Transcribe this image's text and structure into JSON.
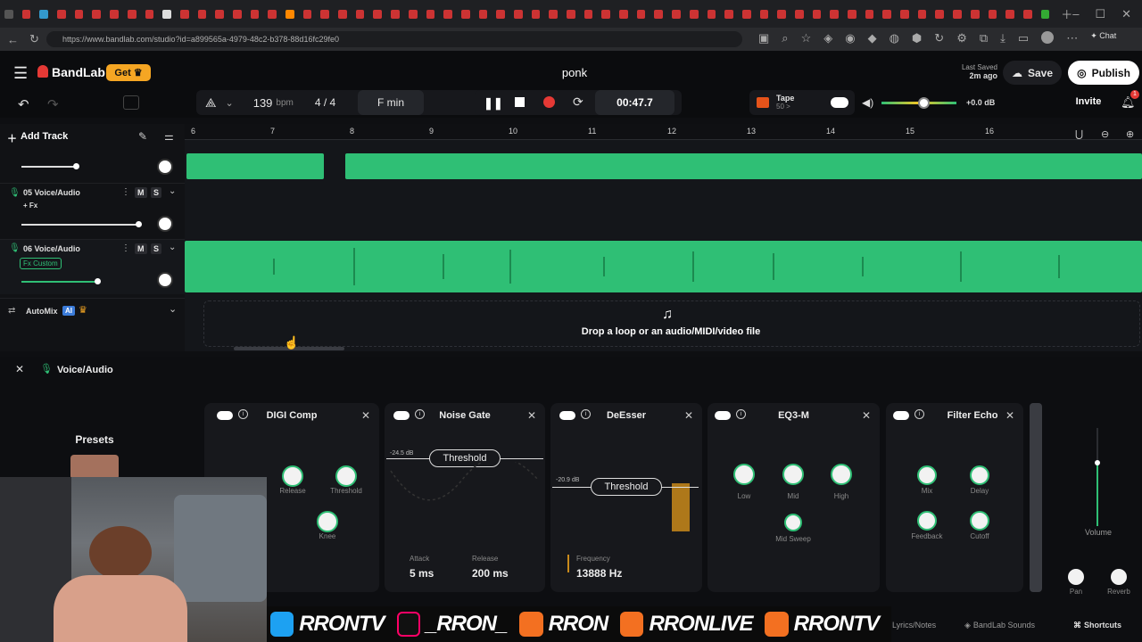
{
  "browser": {
    "url": "https://www.bandlab.com/studio?id=a899565a-4979-48c2-b378-88d16fc29fe0"
  },
  "header": {
    "brand": "BandLab",
    "get_label": "Get",
    "project_title": "ponk",
    "last_saved_label": "Last Saved",
    "last_saved_time": "2m ago",
    "save_label": "Save",
    "publish_label": "Publish"
  },
  "transport": {
    "bpm": "139",
    "bpm_unit": "bpm",
    "time_sig": "4 / 4",
    "key": "F min",
    "time": "00:47.7",
    "tape_label": "Tape",
    "tape_value": "50 >",
    "volume_db": "+0.0 dB",
    "invite_label": "Invite",
    "notification_count": "1"
  },
  "tracks": {
    "add_track_label": "Add Track",
    "items": [
      {
        "name": "05 Voice/Audio",
        "fx": "+ Fx"
      },
      {
        "name": "06 Voice/Audio",
        "fx": "Fx Custom"
      }
    ],
    "automix_label": "AutoMix",
    "ai_badge": "AI",
    "mute": "M",
    "solo": "S"
  },
  "timeline": {
    "ruler": [
      "6",
      "7",
      "8",
      "9",
      "10",
      "11",
      "12",
      "13",
      "14",
      "15",
      "16"
    ],
    "drop_text": "Drop a loop or an audio/MIDI/video file"
  },
  "fx": {
    "panel_title": "Voice/Audio",
    "presets_label": "Presets",
    "cards": {
      "digi": {
        "title": "DIGI Comp",
        "release": "Release",
        "threshold": "Threshold",
        "knee": "Knee"
      },
      "gate": {
        "title": "Noise Gate",
        "select": "Threshold",
        "db": "-24.5 dB",
        "attack_label": "Attack",
        "attack_value": "5 ms",
        "release_label": "Release",
        "release_value": "200 ms"
      },
      "deesser": {
        "title": "DeEsser",
        "select": "Threshold",
        "db": "-20.9 dB",
        "freq_label": "Frequency",
        "freq_value": "13888 Hz"
      },
      "eq": {
        "title": "EQ3-M",
        "low": "Low",
        "mid": "Mid",
        "high": "High",
        "sweep": "Mid Sweep"
      },
      "echo": {
        "title": "Filter Echo",
        "mix": "Mix",
        "delay": "Delay",
        "feedback": "Feedback",
        "cutoff": "Cutoff"
      }
    },
    "volume_label": "Volume",
    "pan_label": "Pan",
    "reverb_label": "Reverb"
  },
  "footer": {
    "lyrics": "Lyrics/Notes",
    "sounds": "BandLab Sounds",
    "shortcuts": "Shortcuts"
  },
  "banner": {
    "twitter": "RRONTV",
    "tiktok": "_RRON_",
    "kick": "RRON",
    "youtube": "RRONLIVE",
    "instagram": "RRONTV"
  },
  "colors": {
    "accent": "#2fbf75",
    "get_badge": "#f5a623",
    "record": "#e53935",
    "background": "#0e0f12"
  }
}
